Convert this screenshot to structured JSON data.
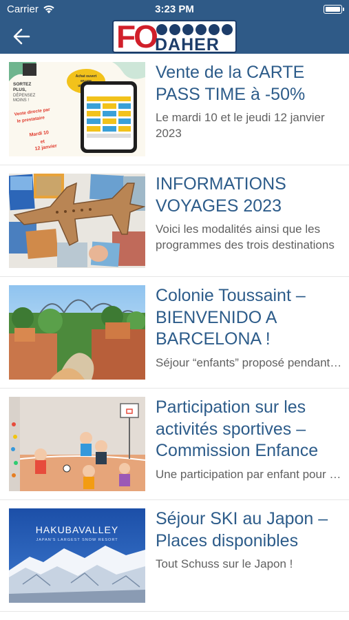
{
  "status_bar": {
    "carrier": "Carrier",
    "time": "3:23 PM"
  },
  "nav": {
    "logo_text_primary": "FO",
    "logo_text_secondary": "DAHER",
    "back_icon": "arrow-left-icon"
  },
  "colors": {
    "bar_bg": "#2f5a87",
    "title": "#2d5c8a",
    "description": "#606060",
    "logo_red": "#d11f2a",
    "logo_navy": "#1d3d6a"
  },
  "articles": [
    {
      "title": "Vente de la CARTE PASS TIME à -50%",
      "description": "Le mardi 10 et le jeudi 12 janvier 2023",
      "image": "pass-time-card-flyer",
      "image_text": {
        "left": [
          "SORTEZ",
          "PLUS,",
          "DÉPENSEZ",
          "MOINS !"
        ],
        "bubble": [
          "Achat ouvert",
          "en une",
          "utilisation"
        ],
        "sale": [
          "Vente directe par",
          "le prestataire",
          "Mardi 10",
          "et",
          "12 janvier"
        ]
      }
    },
    {
      "title": "INFORMATIONS VOYAGES 2023",
      "description": "Voici les modalités ainsi que les programmes des trois destinations",
      "image": "cardboard-plane-travel-photos"
    },
    {
      "title": "Colonie Toussaint – BIENVENIDO A BARCELONA !",
      "description": "Séjour “enfants” proposé pendant les vacances de la Toussaint",
      "image": "theme-park-barcelona"
    },
    {
      "title": "Participation sur les activités sportives – Commission Enfance",
      "description": "Une participation par enfant pour les activités sportives",
      "image": "children-sports-illustration"
    },
    {
      "title": "Séjour SKI au Japon – Places disponibles",
      "description": "Tout Schuss sur le Japon !",
      "image": "hakuba-valley-snow-mountains",
      "image_text": {
        "headline": "HAKUBAVALLEY",
        "tagline": "JAPAN'S LARGEST SNOW RESORT"
      }
    }
  ]
}
